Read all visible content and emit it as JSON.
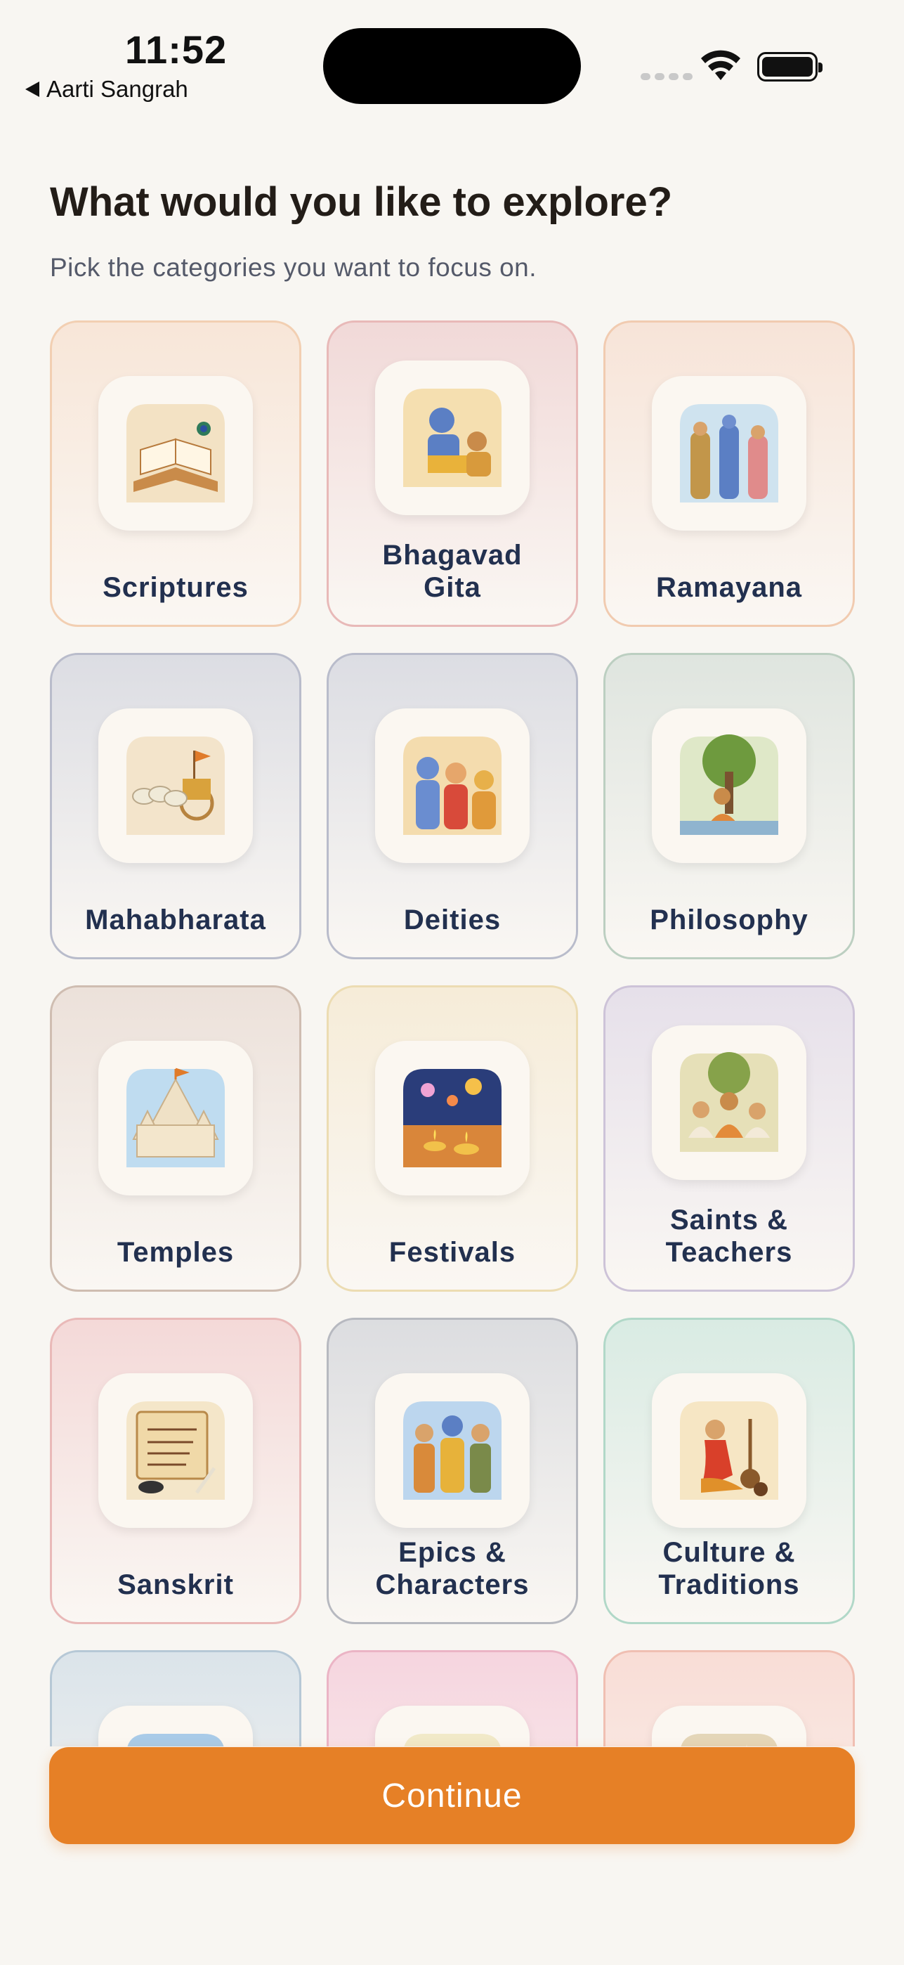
{
  "status_bar": {
    "time": "11:52",
    "back_app": "Aarti Sangrah"
  },
  "header": {
    "title": "What would you like to explore?",
    "subtitle": "Pick the categories you want to focus on."
  },
  "categories": [
    {
      "label": "Scriptures",
      "icon": "book-with-peacock-feather-icon",
      "bg": "#f8e6d8",
      "border": "#f2cfb2"
    },
    {
      "label": "Bhagavad\nGita",
      "icon": "krishna-arjuna-icon",
      "bg": "#f1d9d8",
      "border": "#e8b9b8"
    },
    {
      "label": "Ramayana",
      "icon": "rama-sita-lakshmana-icon",
      "bg": "#f7e4d8",
      "border": "#f1cbb0"
    },
    {
      "label": "Mahabharata",
      "icon": "chariot-horses-icon",
      "bg": "#dcdde3",
      "border": "#b9bccb"
    },
    {
      "label": "Deities",
      "icon": "shiva-parvati-ganesha-icon",
      "bg": "#dcdde3",
      "border": "#b9bccb"
    },
    {
      "label": "Philosophy",
      "icon": "sage-under-tree-icon",
      "bg": "#dfe5df",
      "border": "#bccfc1"
    },
    {
      "label": "Temples",
      "icon": "temple-icon",
      "bg": "#ece1da",
      "border": "#cfbdb1"
    },
    {
      "label": "Festivals",
      "icon": "diya-fireworks-icon",
      "bg": "#f6ecd8",
      "border": "#ecdcb2"
    },
    {
      "label": "Saints &\nTeachers",
      "icon": "gurus-gathering-icon",
      "bg": "#e6e0ea",
      "border": "#cdc3d8"
    },
    {
      "label": "Sanskrit",
      "icon": "sanskrit-scroll-icon",
      "bg": "#f4d9d8",
      "border": "#e9b9b8"
    },
    {
      "label": "Epics &\nCharacters",
      "icon": "epic-heroes-icon",
      "bg": "#dcdde0",
      "border": "#b7b9c0"
    },
    {
      "label": "Culture &\nTraditions",
      "icon": "dancer-with-veena-icon",
      "bg": "#d9ebe3",
      "border": "#b1d8c8"
    },
    {
      "label": "",
      "icon": "mountains-icon",
      "bg": "#dbe4ea",
      "border": "#b6c8d6"
    },
    {
      "label": "",
      "icon": "landscape-icon",
      "bg": "#f6d5df",
      "border": "#ebb4c5"
    },
    {
      "label": "",
      "icon": "temple-sunset-icon",
      "bg": "#f9ddd6",
      "border": "#f0bfb2"
    }
  ],
  "footer": {
    "continue_label": "Continue"
  },
  "colors": {
    "accent": "#e68026",
    "background": "#f8f6f2"
  }
}
